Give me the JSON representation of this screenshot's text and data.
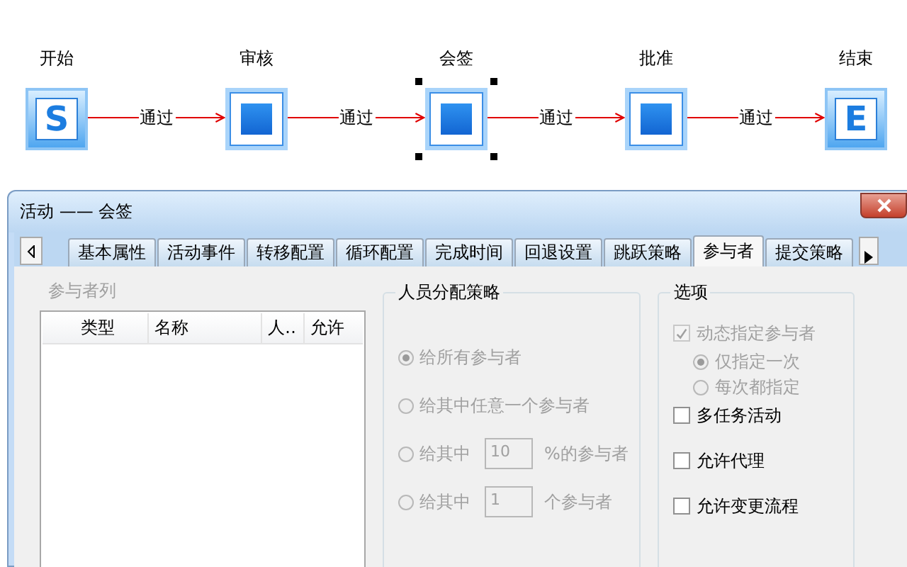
{
  "flow": {
    "nodes": [
      {
        "label": "开始",
        "kind": "start",
        "glyph": "S",
        "selected": false
      },
      {
        "label": "审核",
        "kind": "task",
        "selected": false
      },
      {
        "label": "会签",
        "kind": "task",
        "selected": true
      },
      {
        "label": "批准",
        "kind": "task",
        "selected": false
      },
      {
        "label": "结束",
        "kind": "end",
        "glyph": "E",
        "selected": false
      }
    ],
    "edges": [
      {
        "label": "通过"
      },
      {
        "label": "通过"
      },
      {
        "label": "通过"
      },
      {
        "label": "通过"
      }
    ]
  },
  "window": {
    "title": "活动 —— 会签"
  },
  "tabs": [
    {
      "label": "基本属性",
      "selected": false
    },
    {
      "label": "活动事件",
      "selected": false
    },
    {
      "label": "转移配置",
      "selected": false
    },
    {
      "label": "循环配置",
      "selected": false
    },
    {
      "label": "完成时间",
      "selected": false
    },
    {
      "label": "回退设置",
      "selected": false
    },
    {
      "label": "跳跃策略",
      "selected": false
    },
    {
      "label": "参与者",
      "selected": true
    },
    {
      "label": "提交策略",
      "selected": false
    }
  ],
  "participants": {
    "title": "参与者列",
    "columns": [
      "类型",
      "名称",
      "人‥",
      "允许"
    ]
  },
  "strategy": {
    "title": "人员分配策略",
    "options": [
      {
        "label": "给所有参与者",
        "selected": true,
        "disabled": true
      },
      {
        "label": "给其中任意一个参与者",
        "selected": false,
        "disabled": true
      },
      {
        "label": "给其中",
        "selected": false,
        "disabled": true,
        "value": "10",
        "suffix": "%的参与者"
      },
      {
        "label": "给其中",
        "selected": false,
        "disabled": true,
        "value": "1",
        "suffix": "个参与者"
      }
    ]
  },
  "options": {
    "title": "选项",
    "items": [
      {
        "kind": "checkbox",
        "label": "动态指定参与者",
        "checked": true,
        "disabled": true,
        "children": [
          {
            "kind": "radio",
            "label": "仅指定一次",
            "selected": true,
            "disabled": true
          },
          {
            "kind": "radio",
            "label": "每次都指定",
            "selected": false,
            "disabled": true
          }
        ]
      },
      {
        "kind": "checkbox",
        "label": "多任务活动",
        "checked": false,
        "disabled": false
      },
      {
        "kind": "checkbox",
        "label": "允许代理",
        "checked": false,
        "disabled": false
      },
      {
        "kind": "checkbox",
        "label": "允许变更流程",
        "checked": false,
        "disabled": false
      }
    ]
  }
}
